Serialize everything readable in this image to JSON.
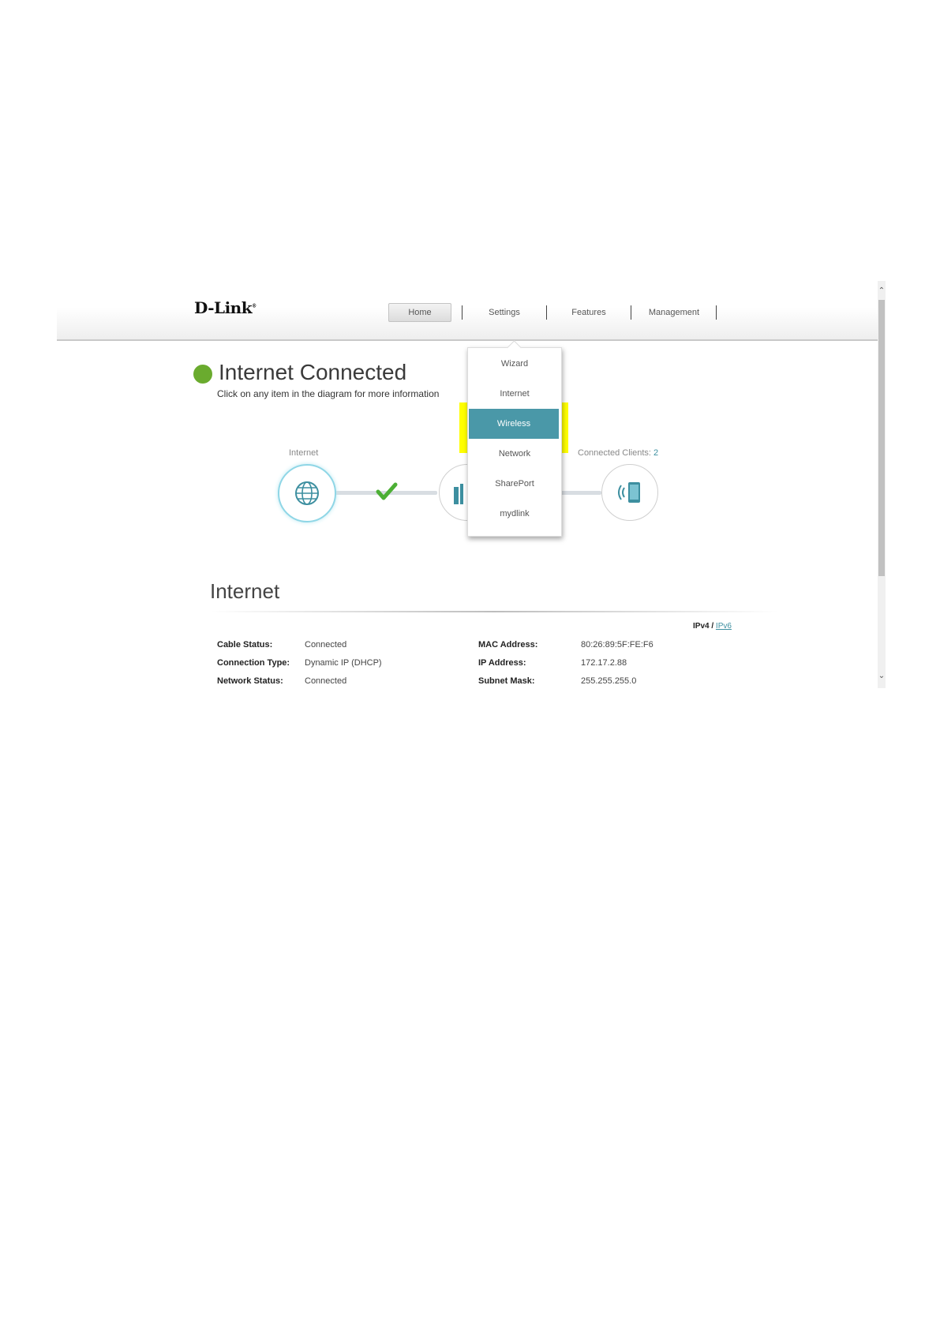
{
  "header": {
    "logo": "D-Link",
    "nav": [
      "Home",
      "Settings",
      "Features",
      "Management"
    ],
    "active_nav": "Home"
  },
  "settings_menu": {
    "items": [
      "Wizard",
      "Internet",
      "Wireless",
      "Network",
      "SharePort",
      "mydlink"
    ],
    "selected": "Wireless",
    "highlight_color": "#ffff00",
    "selected_color": "#4a98a8"
  },
  "status": {
    "title": "Internet Connected",
    "subtitle": "Click on any item in the diagram for more information",
    "color": "#6aab2e"
  },
  "diagram": {
    "internet_label": "Internet",
    "clients_label": "Connected Clients: ",
    "clients_count": "2",
    "icons": [
      "globe-icon",
      "checkmark-icon",
      "router-icon",
      "wireless-device-icon"
    ]
  },
  "internet_section": {
    "title": "Internet",
    "ipv4": "IPv4",
    "separator": "/",
    "ipv6": "IPv6",
    "left": [
      {
        "label": "Cable Status:",
        "value": "Connected"
      },
      {
        "label": "Connection Type:",
        "value": "Dynamic IP (DHCP)"
      },
      {
        "label": "Network Status:",
        "value": "Connected"
      }
    ],
    "right": [
      {
        "label": "MAC Address:",
        "value": "80:26:89:5F:FE:F6"
      },
      {
        "label": "IP Address:",
        "value": "172.17.2.88"
      },
      {
        "label": "Subnet Mask:",
        "value": "255.255.255.0"
      }
    ]
  },
  "scrollbar": {
    "up": "⌃",
    "down": "⌄"
  }
}
